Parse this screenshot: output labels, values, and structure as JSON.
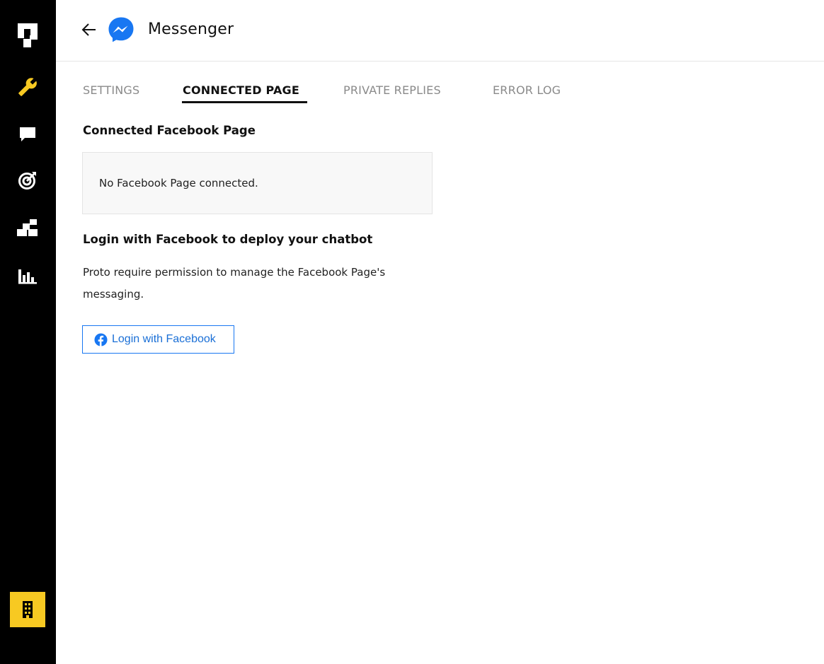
{
  "app": {
    "title": "Messenger",
    "accent": "#f7c922",
    "messenger_blue": "#0084ff",
    "facebook_blue": "#1877f2"
  },
  "sidebar": {
    "items": [
      {
        "name": "logo-icon",
        "icon": "proto-logo"
      },
      {
        "name": "wrench-icon",
        "icon": "wrench",
        "active": true,
        "color": "#f7c922"
      },
      {
        "name": "chat-icon",
        "icon": "chat-bubble"
      },
      {
        "name": "target-icon",
        "icon": "target"
      },
      {
        "name": "blocks-icon",
        "icon": "blocks"
      },
      {
        "name": "bar-chart-icon",
        "icon": "bar-chart"
      }
    ],
    "org_icon": "building"
  },
  "tabs": [
    {
      "label": "SETTINGS",
      "active": false
    },
    {
      "label": "CONNECTED PAGE",
      "active": true
    },
    {
      "label": "PRIVATE REPLIES",
      "active": false
    },
    {
      "label": "ERROR LOG",
      "active": false
    }
  ],
  "connected": {
    "title": "Connected Facebook Page",
    "empty_text": "No Facebook Page connected."
  },
  "login": {
    "title": "Login with Facebook to deploy your chatbot",
    "description": "Proto require permission to manage the Facebook Page's messaging.",
    "button_label": "Login with Facebook"
  }
}
